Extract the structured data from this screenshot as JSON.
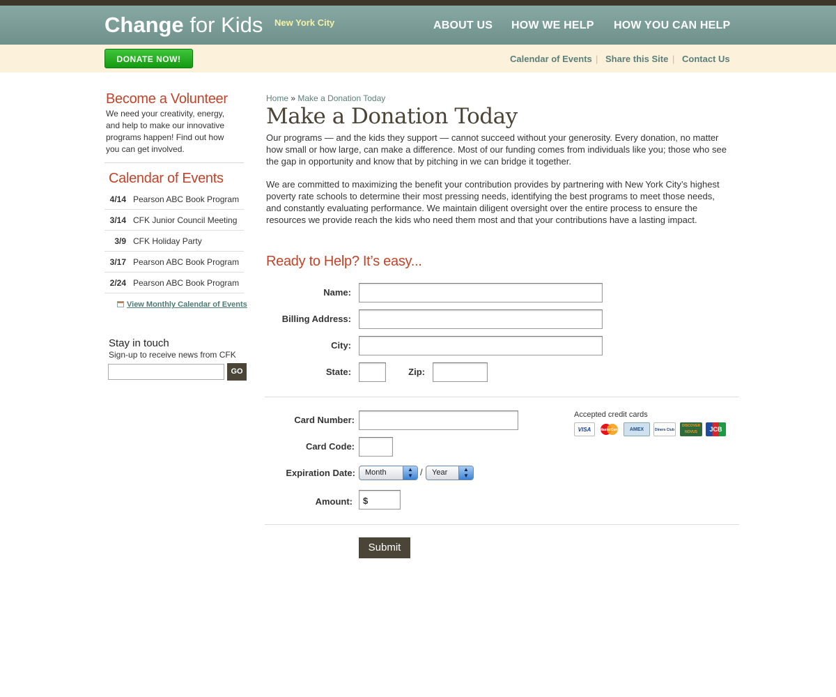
{
  "header": {
    "logo_bold": "Change",
    "logo_light": "for Kids",
    "logo_city": "New York City",
    "nav": [
      "ABOUT US",
      "HOW WE HELP",
      "HOW YOU CAN HELP"
    ]
  },
  "subbar": {
    "donate_label": "DONATE NOW!",
    "links": [
      "Calendar of Events",
      "Share this Site",
      "Contact Us"
    ],
    "separator": "|"
  },
  "sidebar": {
    "volunteer_title": "Become a Volunteer",
    "volunteer_text": "We need your creativity, energy, and help to make our innovative programs happen! Find out how you can get involved.",
    "calendar_title": "Calendar of Events",
    "events": [
      {
        "date": "4/14",
        "name": "Pearson ABC Book Program"
      },
      {
        "date": "3/14",
        "name": "CFK Junior Council Meeting"
      },
      {
        "date": "3/9",
        "name": "CFK Holiday Party"
      },
      {
        "date": "3/17",
        "name": "Pearson ABC Book Program"
      },
      {
        "date": "2/24",
        "name": "Pearson ABC Book Program"
      }
    ],
    "calendar_link": "View Monthly Calendar of Events",
    "stay_title": "Stay in touch",
    "stay_text": "Sign-up to receive news from CFK",
    "go_label": "GO"
  },
  "main": {
    "breadcrumb_home": "Home",
    "breadcrumb_sep": "»",
    "breadcrumb_current": "Make a Donation Today",
    "title": "Make a Donation Today",
    "para1": "Our programs — and the kids they support — cannot succeed without your generosity. Every donation, no matter how small or how large, can make a difference. Most of our funding comes from individuals like you; those who see the gap in opportunity and know that by pitching in we can bridge it together.",
    "para2": "We are committed to maximizing the benefit your contribution provides by partnering with New York City’s highest poverty rate schools to determine their most pressing needs, identifying the best programs to meet those needs, and constantly evaluating performance. We maintain diligent oversight over the entire process to ensure the resources we provide reach the kids who need them most and that your contributions have a lasting impact.",
    "form_title": "Ready to Help? It’s easy..."
  },
  "form": {
    "name_label": "Name:",
    "billing_label": "Billing Address:",
    "city_label": "City:",
    "state_label": "State:",
    "zip_label": "Zip:",
    "card_number_label": "Card Number:",
    "card_code_label": "Card Code:",
    "expiration_label": "Expiration Date:",
    "month_value": "Month",
    "year_value": "Year",
    "date_separator": "/",
    "amount_label": "Amount:",
    "amount_prefix": "$",
    "submit_label": "Submit",
    "accepted_cards_label": "Accepted credit cards",
    "cards": [
      "VISA",
      "MasterCard",
      "AMEX",
      "Diners Club",
      "DISCOVER NOVUS",
      "JCB"
    ]
  },
  "colors": {
    "header_teal": "#7a9c97",
    "accent_red": "#c0442a",
    "dark_olive": "#4a4536",
    "donate_green": "#22a81e",
    "subbar_cream": "#fcf1da"
  }
}
